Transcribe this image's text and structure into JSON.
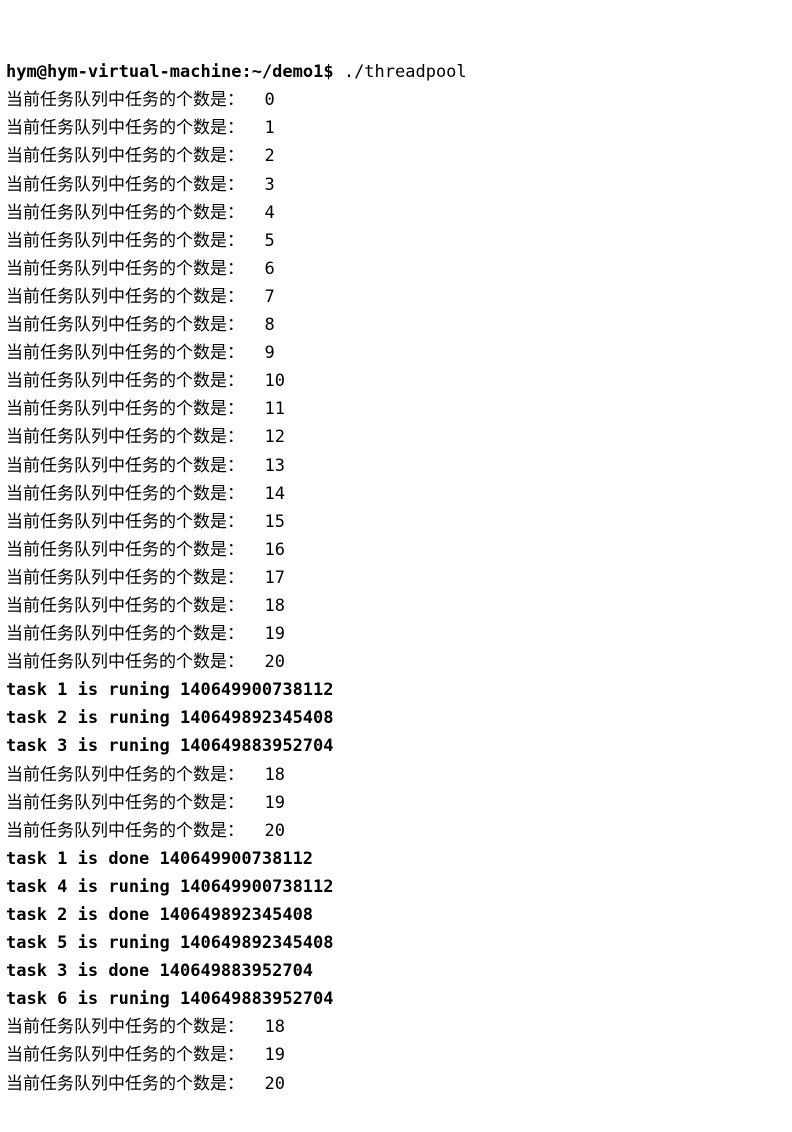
{
  "prompt": {
    "user": "hym",
    "sep_at": "@",
    "host": "hym-virtual-machine",
    "sep_colon": ":",
    "path": "~/demo1",
    "dollar": "$",
    "command": " ./threadpool"
  },
  "queue_label": "当前任务队列中任务的个数是：  ",
  "lines": [
    {
      "kind": "queue",
      "count": "0"
    },
    {
      "kind": "queue",
      "count": "1"
    },
    {
      "kind": "queue",
      "count": "2"
    },
    {
      "kind": "queue",
      "count": "3"
    },
    {
      "kind": "queue",
      "count": "4"
    },
    {
      "kind": "queue",
      "count": "5"
    },
    {
      "kind": "queue",
      "count": "6"
    },
    {
      "kind": "queue",
      "count": "7"
    },
    {
      "kind": "queue",
      "count": "8"
    },
    {
      "kind": "queue",
      "count": "9"
    },
    {
      "kind": "queue",
      "count": "10"
    },
    {
      "kind": "queue",
      "count": "11"
    },
    {
      "kind": "queue",
      "count": "12"
    },
    {
      "kind": "queue",
      "count": "13"
    },
    {
      "kind": "queue",
      "count": "14"
    },
    {
      "kind": "queue",
      "count": "15"
    },
    {
      "kind": "queue",
      "count": "16"
    },
    {
      "kind": "queue",
      "count": "17"
    },
    {
      "kind": "queue",
      "count": "18"
    },
    {
      "kind": "queue",
      "count": "19"
    },
    {
      "kind": "queue",
      "count": "20"
    },
    {
      "kind": "status",
      "text": "task 1 is runing 140649900738112"
    },
    {
      "kind": "status",
      "text": "task 2 is runing 140649892345408"
    },
    {
      "kind": "status",
      "text": "task 3 is runing 140649883952704"
    },
    {
      "kind": "queue",
      "count": "18"
    },
    {
      "kind": "queue",
      "count": "19"
    },
    {
      "kind": "queue",
      "count": "20"
    },
    {
      "kind": "status",
      "text": "task 1 is done 140649900738112"
    },
    {
      "kind": "status",
      "text": "task 4 is runing 140649900738112"
    },
    {
      "kind": "status",
      "text": "task 2 is done 140649892345408"
    },
    {
      "kind": "status",
      "text": "task 5 is runing 140649892345408"
    },
    {
      "kind": "status",
      "text": "task 3 is done 140649883952704"
    },
    {
      "kind": "status",
      "text": "task 6 is runing 140649883952704"
    },
    {
      "kind": "queue",
      "count": "18"
    },
    {
      "kind": "queue",
      "count": "19"
    },
    {
      "kind": "queue",
      "count": "20"
    }
  ]
}
